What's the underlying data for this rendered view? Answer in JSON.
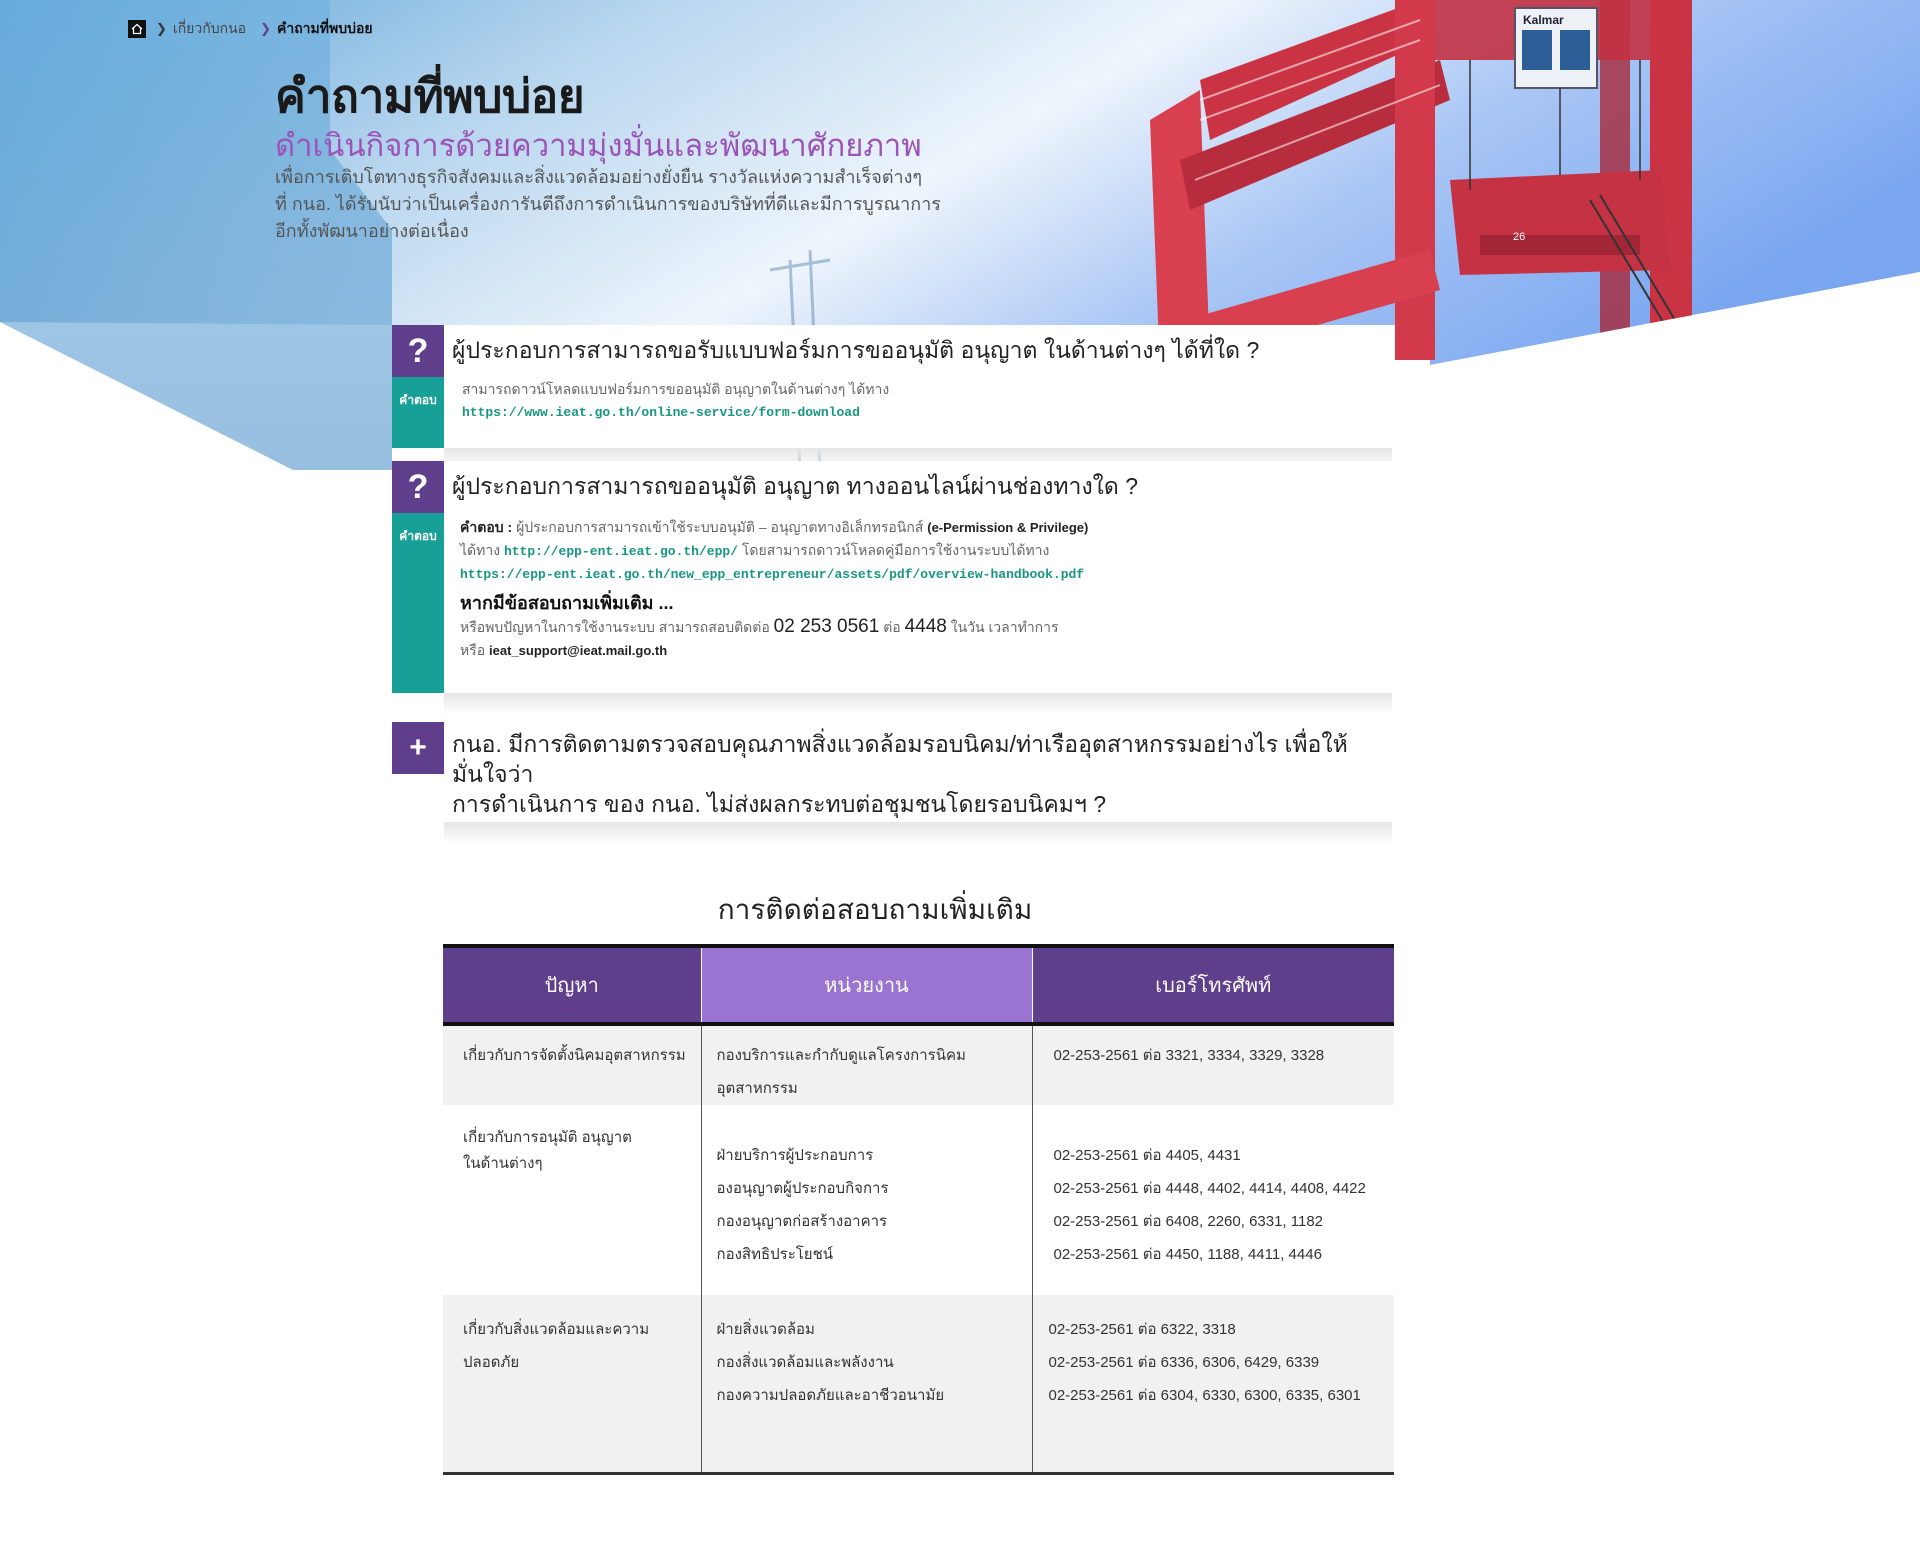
{
  "breadcrumb": {
    "items": [
      {
        "label": "เกี่ยวกับกนอ"
      },
      {
        "label": "คำถามที่พบบ่อย"
      }
    ]
  },
  "header": {
    "title": "คำถามที่พบบ่อย",
    "subtitle": "ดำเนินกิจการด้วยความมุ่งมั่นและพัฒนาศักยภาพ",
    "description_lines": [
      "เพื่อการเติบโตทางธุรกิจสังคมและสิ่งแวดล้อมอย่างยั่งยืน รางวัลแห่งความสำเร็จต่างๆ",
      "ที่ กนอ. ได้รับนับว่าเป็นเครื่องการันตีถึงการดำเนินการของบริษัทที่ดีและมีการบูรณาการ",
      "อีกทั้งพัฒนาอย่างต่อเนื่อง"
    ]
  },
  "faq": [
    {
      "q_icon": "?",
      "answer_label": "คำตอบ",
      "question": "ผู้ประกอบการสามารถขอรับแบบฟอร์มการขออนุมัติ อนุญาต ในด้านต่างๆ ได้ที่ใด ?",
      "answer_text": "สามารถดาวน์โหลดแบบฟอร์มการขออนุมัติ อนุญาตในด้านต่างๆ ได้ทาง",
      "answer_link": "https://www.ieat.go.th/online-service/form-download"
    },
    {
      "q_icon": "?",
      "answer_label": "คำตอบ",
      "question": "ผู้ประกอบการสามารถขออนุมัติ อนุญาต ทางออนไลน์ผ่านช่องทางใด ?",
      "answer_prefix": "คำตอบ",
      "answer_line1": "ผู้ประกอบการสามารถเข้าใช้ระบบอนุมัติ – อนุญาตทางอิเล็กทรอนิกส์",
      "answer_line1_bold": "(e-Permission & Privilege)",
      "answer_line2_pre": "ได้ทาง",
      "answer_link1": "http://epp-ent.ieat.go.th/epp/",
      "answer_line2_post": "โดยสามารถดาวน์โหลดคู่มือการใช้งานระบบได้ทาง",
      "answer_link2": "https://epp-ent.ieat.go.th/new_epp_entrepreneur/assets/pdf/overview-handbook.pdf",
      "more_title": "หากมีข้อสอบถามเพิ่มเติม ...",
      "more_line_pre": "หรือพบปัญหาในการใช้งานระบบ สามารถสอบติดต่อ",
      "more_phone": "02 253 0561",
      "more_ext_label": "ต่อ",
      "more_ext": "4448",
      "more_line_post": "ในวัน เวลาทำการ",
      "more_or": "หรือ",
      "more_email": "ieat_support@ieat.mail.go.th"
    },
    {
      "plus_icon": "+",
      "question_line1": "กนอ. มีการติดตามตรวจสอบคุณภาพสิ่งแวดล้อมรอบนิคม/ท่าเรืออุตสาหกรรมอย่างไร เพื่อให้มั่นใจว่า",
      "question_line2": "การดำเนินการ ของ กนอ. ไม่ส่งผลกระทบต่อชุมชนโดยรอบนิคมฯ ?"
    }
  ],
  "contact": {
    "title": "การติดต่อสอบถามเพิ่มเติม",
    "headers": [
      "ปัญหา",
      "หน่วยงาน",
      "เบอร์โทรศัพท์"
    ],
    "rows": [
      {
        "problem": [
          "เกี่ยวกับการจัดตั้งนิคมอุตสาหกรรม"
        ],
        "units": [
          "กองบริการและกำกับดูแลโครงการนิคมอุตสาหกรรม"
        ],
        "phones": [
          "02-253-2561 ต่อ 3321, 3334, 3329, 3328"
        ]
      },
      {
        "problem": [
          "เกี่ยวกับการอนุมัติ อนุญาต",
          "ในด้านต่างๆ"
        ],
        "units": [
          "ฝ่ายบริการผู้ประกอบการ",
          "องอนุญาตผู้ประกอบกิจการ",
          "กองอนุญาตก่อสร้างอาคาร",
          "กองสิทธิประโยชน์"
        ],
        "phones": [
          "02-253-2561 ต่อ 4405, 4431",
          "02-253-2561 ต่อ 4448, 4402, 4414, 4408, 4422",
          "02-253-2561 ต่อ 6408, 2260, 6331, 1182",
          "02-253-2561 ต่อ 4450, 1188, 4411, 4446"
        ]
      },
      {
        "problem": [
          "เกี่ยวกับสิ่งแวดล้อมและความปลอดภัย"
        ],
        "units": [
          "ฝ่ายสิ่งแวดล้อม",
          "กองสิ่งแวดล้อมและพลังงาน",
          "กองความปลอดภัยและอาชีวอนามัย"
        ],
        "phones": [
          "02-253-2561 ต่อ 6322, 3318",
          "02-253-2561 ต่อ 6336, 6306, 6429, 6339",
          "02-253-2561 ต่อ 6304, 6330, 6300, 6335, 6301"
        ]
      }
    ]
  },
  "hero_image": {
    "crane_brand_text": "Kalmar",
    "crane_number": "26"
  },
  "colors": {
    "purple": "#5f3f8c",
    "light_purple": "#9a74d0",
    "teal": "#17a097",
    "subtitle": "#9b53b8",
    "link": "#17977f"
  }
}
